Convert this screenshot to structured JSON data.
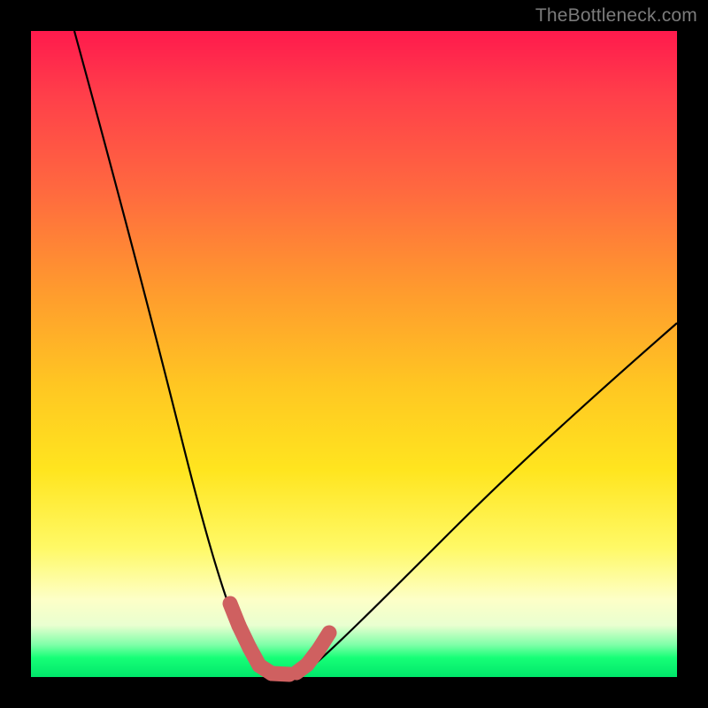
{
  "watermark": "TheBottleneck.com",
  "colors": {
    "frame": "#000000",
    "curve": "#000000",
    "marker": "#cd5c5c",
    "gradient_stops": [
      "#ff1a4d",
      "#ff6a3f",
      "#ffc722",
      "#fff966",
      "#e9ffd0",
      "#00e66a"
    ]
  },
  "chart_data": {
    "type": "line",
    "title": "",
    "xlabel": "",
    "ylabel": "",
    "xlim": [
      0,
      100
    ],
    "ylim": [
      0,
      100
    ],
    "grid": false,
    "legend": false,
    "notes": "V-shaped bottleneck curve. y≈100 at x≈7, drops to y≈0 near x≈33–40 (flat minimum), rises to y≈42 at x≈100. Salmon markers trace the valley only.",
    "series": [
      {
        "name": "curve",
        "x": [
          7,
          10,
          13,
          16,
          19,
          22,
          25,
          28,
          30,
          32,
          33,
          35,
          37,
          39,
          41,
          43,
          48,
          55,
          62,
          70,
          78,
          86,
          93,
          100
        ],
        "y": [
          100,
          87,
          75,
          63,
          52,
          41,
          30,
          20,
          13,
          7,
          4,
          1,
          0,
          0,
          1,
          3,
          7,
          12,
          18,
          24,
          30,
          35,
          39,
          42
        ]
      },
      {
        "name": "valley-markers",
        "x": [
          30,
          31,
          32,
          33,
          35,
          37,
          39,
          41,
          42,
          43,
          44
        ],
        "y": [
          12,
          9,
          6,
          3,
          1,
          0,
          0,
          1,
          2,
          3,
          5
        ]
      }
    ]
  }
}
